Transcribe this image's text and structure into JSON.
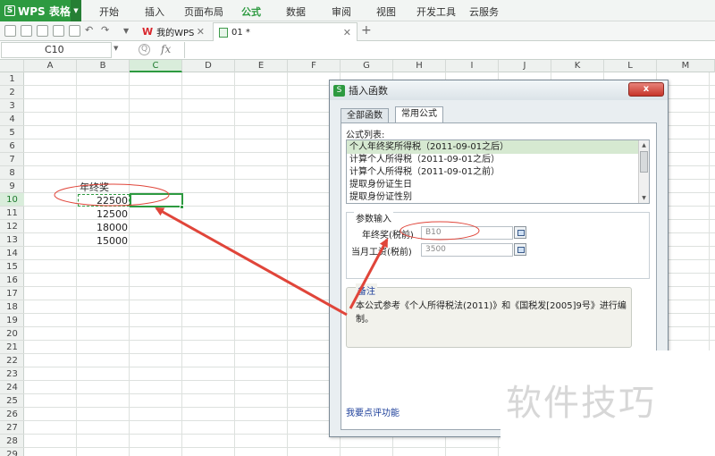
{
  "app": {
    "name": "WPS 表格",
    "logo": "S"
  },
  "ribbon_tabs": [
    "开始",
    "插入",
    "页面布局",
    "公式",
    "数据",
    "审阅",
    "视图",
    "开发工具",
    "云服务"
  ],
  "ribbon_active": "公式",
  "doc_tabs": [
    {
      "label": "我的WPS",
      "icon": "wps-icon"
    },
    {
      "label": "01 *",
      "icon": "spreadsheet-icon"
    }
  ],
  "formula_bar": {
    "cell_ref": "C10",
    "fx": "fx",
    "value": ""
  },
  "columns": [
    "A",
    "B",
    "C",
    "D",
    "E",
    "F",
    "G",
    "H",
    "I",
    "J",
    "K",
    "L",
    "M"
  ],
  "selected_column": "C",
  "rows": [
    "1",
    "2",
    "3",
    "4",
    "5",
    "6",
    "7",
    "8",
    "9",
    "10",
    "11",
    "12",
    "13",
    "14",
    "15",
    "16",
    "17",
    "18",
    "19",
    "20",
    "21",
    "22",
    "23",
    "24",
    "25",
    "26",
    "27",
    "28",
    "29"
  ],
  "selected_row": "10",
  "cells": {
    "b9": "年终奖",
    "b10": "22500",
    "b11": "12500",
    "b12": "18000",
    "b13": "15000"
  },
  "dialog": {
    "title": "插入函数",
    "close_label": "x",
    "tabs": [
      "全部函数",
      "常用公式"
    ],
    "active_tab": "常用公式",
    "list_label": "公式列表:",
    "formulas": [
      "个人年终奖所得税（2011-09-01之后）",
      "计算个人所得税（2011-09-01之后）",
      "计算个人所得税（2011-09-01之前）",
      "提取身份证生日",
      "提取身份证性别"
    ],
    "selected_formula_index": 0,
    "params_label": "参数输入",
    "params": [
      {
        "label": "年终奖(税前)",
        "value": "B10"
      },
      {
        "label": "当月工资(税前)",
        "value": "3500"
      }
    ],
    "note_title": "备注",
    "note_text": "本公式参考《个人所得税法(2011)》和《国税发[2005]9号》进行编制。",
    "feedback_link": "我要点评功能"
  },
  "watermark": "软件技巧",
  "colors": {
    "brand_green": "#2d9a40",
    "annotation_red": "#e0453a",
    "link_blue": "#1d3f9a"
  }
}
